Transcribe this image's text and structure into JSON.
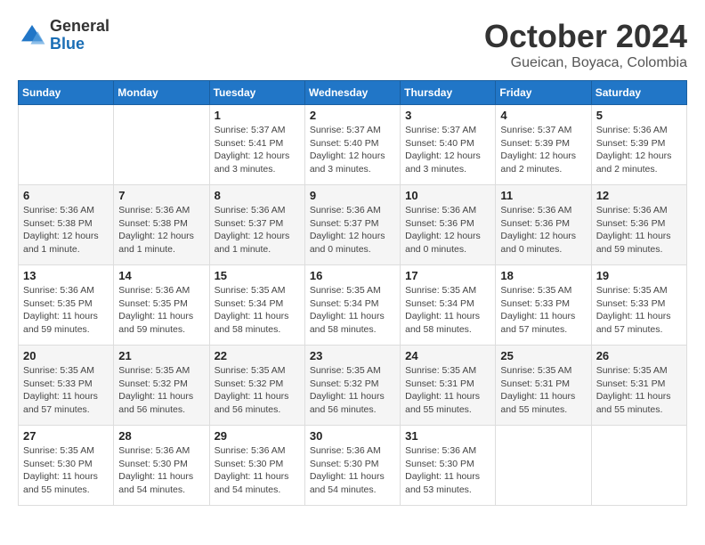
{
  "header": {
    "logo_line1": "General",
    "logo_line2": "Blue",
    "month_title": "October 2024",
    "subtitle": "Gueican, Boyaca, Colombia"
  },
  "weekdays": [
    "Sunday",
    "Monday",
    "Tuesday",
    "Wednesday",
    "Thursday",
    "Friday",
    "Saturday"
  ],
  "weeks": [
    [
      {
        "day": "",
        "info": ""
      },
      {
        "day": "",
        "info": ""
      },
      {
        "day": "1",
        "info": "Sunrise: 5:37 AM\nSunset: 5:41 PM\nDaylight: 12 hours and 3 minutes."
      },
      {
        "day": "2",
        "info": "Sunrise: 5:37 AM\nSunset: 5:40 PM\nDaylight: 12 hours and 3 minutes."
      },
      {
        "day": "3",
        "info": "Sunrise: 5:37 AM\nSunset: 5:40 PM\nDaylight: 12 hours and 3 minutes."
      },
      {
        "day": "4",
        "info": "Sunrise: 5:37 AM\nSunset: 5:39 PM\nDaylight: 12 hours and 2 minutes."
      },
      {
        "day": "5",
        "info": "Sunrise: 5:36 AM\nSunset: 5:39 PM\nDaylight: 12 hours and 2 minutes."
      }
    ],
    [
      {
        "day": "6",
        "info": "Sunrise: 5:36 AM\nSunset: 5:38 PM\nDaylight: 12 hours and 1 minute."
      },
      {
        "day": "7",
        "info": "Sunrise: 5:36 AM\nSunset: 5:38 PM\nDaylight: 12 hours and 1 minute."
      },
      {
        "day": "8",
        "info": "Sunrise: 5:36 AM\nSunset: 5:37 PM\nDaylight: 12 hours and 1 minute."
      },
      {
        "day": "9",
        "info": "Sunrise: 5:36 AM\nSunset: 5:37 PM\nDaylight: 12 hours and 0 minutes."
      },
      {
        "day": "10",
        "info": "Sunrise: 5:36 AM\nSunset: 5:36 PM\nDaylight: 12 hours and 0 minutes."
      },
      {
        "day": "11",
        "info": "Sunrise: 5:36 AM\nSunset: 5:36 PM\nDaylight: 12 hours and 0 minutes."
      },
      {
        "day": "12",
        "info": "Sunrise: 5:36 AM\nSunset: 5:36 PM\nDaylight: 11 hours and 59 minutes."
      }
    ],
    [
      {
        "day": "13",
        "info": "Sunrise: 5:36 AM\nSunset: 5:35 PM\nDaylight: 11 hours and 59 minutes."
      },
      {
        "day": "14",
        "info": "Sunrise: 5:36 AM\nSunset: 5:35 PM\nDaylight: 11 hours and 59 minutes."
      },
      {
        "day": "15",
        "info": "Sunrise: 5:35 AM\nSunset: 5:34 PM\nDaylight: 11 hours and 58 minutes."
      },
      {
        "day": "16",
        "info": "Sunrise: 5:35 AM\nSunset: 5:34 PM\nDaylight: 11 hours and 58 minutes."
      },
      {
        "day": "17",
        "info": "Sunrise: 5:35 AM\nSunset: 5:34 PM\nDaylight: 11 hours and 58 minutes."
      },
      {
        "day": "18",
        "info": "Sunrise: 5:35 AM\nSunset: 5:33 PM\nDaylight: 11 hours and 57 minutes."
      },
      {
        "day": "19",
        "info": "Sunrise: 5:35 AM\nSunset: 5:33 PM\nDaylight: 11 hours and 57 minutes."
      }
    ],
    [
      {
        "day": "20",
        "info": "Sunrise: 5:35 AM\nSunset: 5:33 PM\nDaylight: 11 hours and 57 minutes."
      },
      {
        "day": "21",
        "info": "Sunrise: 5:35 AM\nSunset: 5:32 PM\nDaylight: 11 hours and 56 minutes."
      },
      {
        "day": "22",
        "info": "Sunrise: 5:35 AM\nSunset: 5:32 PM\nDaylight: 11 hours and 56 minutes."
      },
      {
        "day": "23",
        "info": "Sunrise: 5:35 AM\nSunset: 5:32 PM\nDaylight: 11 hours and 56 minutes."
      },
      {
        "day": "24",
        "info": "Sunrise: 5:35 AM\nSunset: 5:31 PM\nDaylight: 11 hours and 55 minutes."
      },
      {
        "day": "25",
        "info": "Sunrise: 5:35 AM\nSunset: 5:31 PM\nDaylight: 11 hours and 55 minutes."
      },
      {
        "day": "26",
        "info": "Sunrise: 5:35 AM\nSunset: 5:31 PM\nDaylight: 11 hours and 55 minutes."
      }
    ],
    [
      {
        "day": "27",
        "info": "Sunrise: 5:35 AM\nSunset: 5:30 PM\nDaylight: 11 hours and 55 minutes."
      },
      {
        "day": "28",
        "info": "Sunrise: 5:36 AM\nSunset: 5:30 PM\nDaylight: 11 hours and 54 minutes."
      },
      {
        "day": "29",
        "info": "Sunrise: 5:36 AM\nSunset: 5:30 PM\nDaylight: 11 hours and 54 minutes."
      },
      {
        "day": "30",
        "info": "Sunrise: 5:36 AM\nSunset: 5:30 PM\nDaylight: 11 hours and 54 minutes."
      },
      {
        "day": "31",
        "info": "Sunrise: 5:36 AM\nSunset: 5:30 PM\nDaylight: 11 hours and 53 minutes."
      },
      {
        "day": "",
        "info": ""
      },
      {
        "day": "",
        "info": ""
      }
    ]
  ]
}
